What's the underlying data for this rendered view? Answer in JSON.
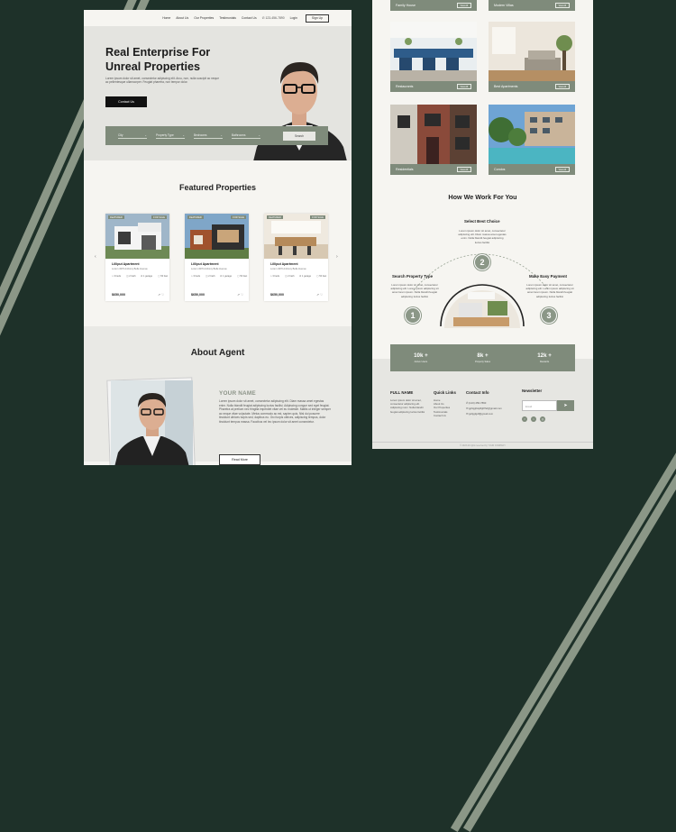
{
  "nav": {
    "items": [
      "Home",
      "About Us",
      "Our Properties",
      "Testimonials",
      "Contact Us"
    ],
    "phone": "123-456-7890",
    "login": "Login",
    "signup": "Sign Up"
  },
  "hero": {
    "title_line1": "Real Enterprise For",
    "title_line2": "Unreal Properties",
    "body": "Lorem ipsum dolor sit amet, consectetur adipiscing elit. Arcu, non, nulla suscipit ac neque ac pellentesque ullamcorper. Feugiat pharetra, non tempor dolor.",
    "cta": "Contact Us",
    "search": {
      "city": "City",
      "property_type": "Property Type",
      "bedrooms": "Bedrooms",
      "bathrooms": "Bathrooms",
      "button": "Search"
    }
  },
  "featured": {
    "title": "Featured Properties",
    "cards": [
      {
        "tag1": "FEATURED",
        "tag2": "FOR SALE",
        "title": "Lilliput Apartment",
        "address": "Lorem 4370 Anthony Belle Avenue",
        "beds": "3 beds",
        "baths": "2 bath",
        "garage": "1 garage",
        "area": "50 feet",
        "price": "$650,000"
      },
      {
        "tag1": "FEATURED",
        "tag2": "FOR SALE",
        "title": "Lilliput Apartment",
        "address": "Lorem 4370 Anthony Belle Avenue",
        "beds": "3 beds",
        "baths": "2 bath",
        "garage": "1 garage",
        "area": "50 feet",
        "price": "$650,000"
      },
      {
        "tag1": "FEATURED",
        "tag2": "FOR SALE",
        "title": "Lilliput Apartment",
        "address": "Lorem 4370 Anthony Belle Avenue",
        "beds": "3 beds",
        "baths": "2 bath",
        "garage": "1 garage",
        "area": "50 feet",
        "price": "$650,000"
      }
    ]
  },
  "about": {
    "title": "About Agent",
    "name": "YOUR NAME",
    "body": "Lorem ipsum dolor sit amet, consectetur adipiscing elit. Diam massa amet egestas enim. Nulla blandit feugiat adipiscing luctus facilisi. Adipiscing congue sed eget feugiat. Pharetra at pretium nec fringilla imperdiet vitae vel eu molestie. Mattis ut integer semper ac neque vitae vulputate. Metus commodo ac est, sapien quis. Nisl dui posuere tincidunt ultrices turpis sed, dapibus eu. Orci turpis ultrices, adipiscing tempus, dolor tincidunt tempus massa. Faucibus vel leo ipsum dolor sit amet consectetur.",
    "button": "Read More"
  },
  "categories": [
    {
      "label": "Family House",
      "button": "View All"
    },
    {
      "label": "Modern Villas",
      "button": "View All"
    },
    {
      "label": "Restaurants",
      "button": "View All"
    },
    {
      "label": "Best Apartments",
      "button": "View All"
    },
    {
      "label": "Residentials",
      "button": "View All"
    },
    {
      "label": "Condos",
      "button": "View All"
    }
  ],
  "how": {
    "title": "How We Work For You",
    "steps": [
      {
        "num": "1",
        "title": "Search Property Type",
        "desc": "Lorem ipsum dolor sit amet, consectetur adipiscing elit. Lorem ipsum adipiscing sit amet lorem ipsum. Nulla blandit feugiat adipiscing luctus facilisi"
      },
      {
        "num": "2",
        "title": "Select Best Choice",
        "desc": "Lorem ipsum dolor sit amet, consectetur adipiscing elit. Diam massa amet egestas enim. Nulla blandit feugiat adipiscing luctus facilisi"
      },
      {
        "num": "3",
        "title": "Make Easy Payment",
        "desc": "Lorem ipsum dolor sit amet, consectetur adipiscing elit. Lorem ipsum adipiscing sit amet lorem ipsum. Nulla blandit feugiat adipiscing luctus facilisi"
      }
    ]
  },
  "stats": [
    {
      "value": "10k +",
      "label": "Active Users"
    },
    {
      "value": "8k +",
      "label": "Property Sales"
    },
    {
      "value": "12k +",
      "label": "Rewards"
    }
  ],
  "footer": {
    "brand": "FULL NAME",
    "brand_text": "Lorem ipsum dolor sit amet, consectetur adipiscing elit. Adipiscing nunc. Nulla blandit feugiat adipiscing luctus facilisi",
    "quick_title": "Quick Links",
    "quick_links": [
      "Home",
      "About Us",
      "Our Properties",
      "Testimonials",
      "Contact Us"
    ],
    "contact_title": "Contact Info",
    "phone": "(123) 456-7890",
    "email1": "gpfsjghsijdfghfhd@gmail.com",
    "email2": "gshjgfgdf@gmail.com",
    "newsletter_title": "Newsletter",
    "newsletter_placeholder": "Email",
    "copyright": "© 2023 All rights reserved by YOUR COMPANY"
  },
  "colors": {
    "background": "#1e3129",
    "accent": "#7f8b7b",
    "panel": "#f6f5f1"
  }
}
